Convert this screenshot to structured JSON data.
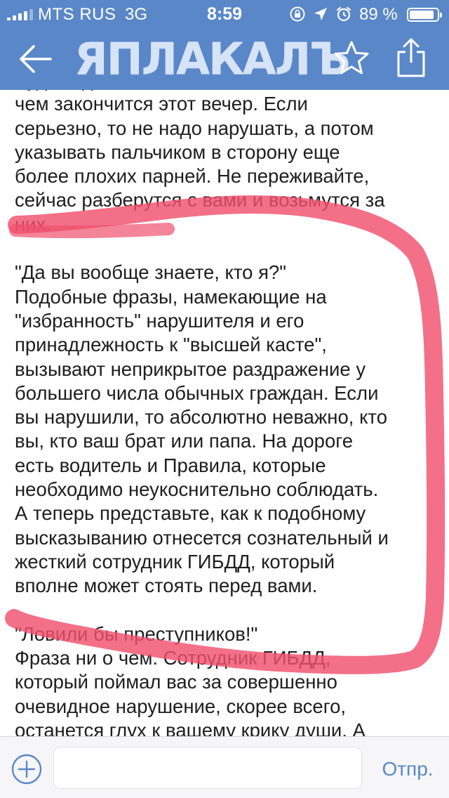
{
  "status_bar": {
    "carrier": "MTS RUS",
    "network": "3G",
    "time": "8:59",
    "battery_percent_text": "89 %",
    "battery_level": 0.89,
    "signal_bars_filled": 4,
    "signal_bars_total": 5,
    "icons": [
      "rotation-lock-icon",
      "location-arrow-icon",
      "alarm-clock-icon"
    ]
  },
  "nav": {
    "logo_text": "ЯПЛАКАЛЪ",
    "back_icon": "back-arrow-icon",
    "favorite_icon": "star-icon",
    "share_icon": "share-icon"
  },
  "article": {
    "paragraphs": [
      {
        "lines": [
          "Будете давить на гаишника и, кто знает,",
          "чем закончится этот вечер. Если",
          "серьезно, то не надо нарушать, а потом",
          "указывать пальчиком в сторону еще",
          "более плохих парней. Не переживайте,",
          "сейчас разберутся с вами и возьмутся за",
          "них."
        ]
      },
      {
        "lines": [
          "\"Да вы вообще знаете, кто я?\"",
          "Подобные фразы, намекающие на",
          "\"избранность\" нарушителя и его",
          "принадлежность к \"высшей касте\",",
          "вызывают неприкрытое раздражение у",
          "большего числа обычных граждан. Если",
          "вы нарушили, то абсолютно неважно, кто",
          "вы, кто ваш брат или папа. На дороге",
          "есть водитель и Правила, которые",
          "необходимо неукоснительно соблюдать.",
          "А теперь представьте, как к подобному",
          "высказыванию отнесется сознательный и",
          "жесткий сотрудник ГИБДД, который",
          "вполне может стоять перед вами."
        ]
      },
      {
        "lines": [
          "\"Ловили бы преступников!\"",
          "Фраза ни о чем. Сотрудник ГИБДД,",
          "который поймал вас за совершенно",
          "очевидное нарушение, скорее всего,",
          "останется глух к вашему крику души. А"
        ]
      }
    ]
  },
  "annotation": {
    "color": "#f0506e",
    "description_icon": "red-marker-outline"
  },
  "composer": {
    "add_icon": "plus-circle-icon",
    "input_value": "",
    "input_placeholder": "",
    "send_label": "Отпр."
  },
  "colors": {
    "header_bg": "#5a87c8",
    "text": "#1e1e1e",
    "accent": "#5a87c8",
    "marker": "#f0506e"
  }
}
